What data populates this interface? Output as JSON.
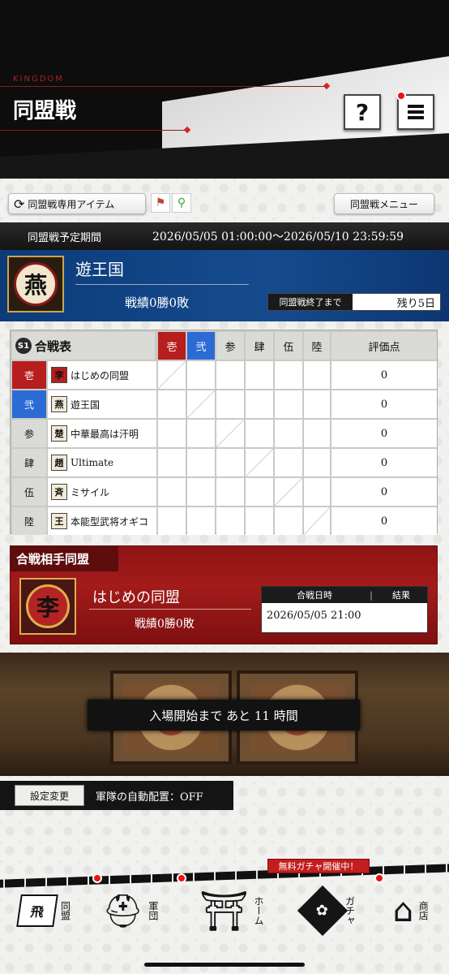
{
  "header": {
    "kingdom_label": "KINGDOM",
    "title": "同盟戦",
    "help_label": "?"
  },
  "toolbar": {
    "items_button": "同盟戦専用アイテム",
    "menu_button": "同盟戦メニュー"
  },
  "period": {
    "label": "同盟戦予定期間",
    "value": "2026/05/05 01:00:00～2026/05/10 23:59:59"
  },
  "my_alliance": {
    "emblem_char": "燕",
    "name": "遊王国",
    "record": "戦績0勝0敗",
    "remaining_label": "同盟戦終了まで",
    "remaining_value": "残り5日"
  },
  "battle_table": {
    "season_badge": "S1",
    "title": "合戦表",
    "columns": [
      "壱",
      "弐",
      "参",
      "肆",
      "伍",
      "陸"
    ],
    "score_header": "評価点",
    "rows": [
      {
        "label": "壱",
        "emblem": "李",
        "name": "はじめの同盟",
        "score": "0"
      },
      {
        "label": "弐",
        "emblem": "燕",
        "name": "遊王国",
        "score": "0"
      },
      {
        "label": "参",
        "emblem": "楚",
        "name": "中華最高は汗明",
        "score": "0"
      },
      {
        "label": "肆",
        "emblem": "趙",
        "name": "Ultimate",
        "score": "0"
      },
      {
        "label": "伍",
        "emblem": "斉",
        "name": "ミサイル",
        "score": "0"
      },
      {
        "label": "陸",
        "emblem": "王",
        "name": "本能型武将オギコ",
        "score": "0"
      }
    ]
  },
  "opponent": {
    "section_title": "合戦相手同盟",
    "emblem_char": "李",
    "name": "はじめの同盟",
    "record": "戦績0勝0敗",
    "date_header": "合戦日時",
    "result_header": "結果",
    "date_value": "2026/05/05 21:00"
  },
  "entry": {
    "countdown": "入場開始まで あと 11 時間"
  },
  "settings": {
    "button": "設定変更",
    "auto_deploy": "軍隊の自動配置：OFF"
  },
  "bottom_nav": {
    "promo": "無料ガチャ開催中！",
    "items": [
      {
        "label": "同盟",
        "icon": "飛"
      },
      {
        "label": "軍団",
        "icon": "helmet-icon"
      },
      {
        "label": "ホーム",
        "icon": "castle-icon"
      },
      {
        "label": "ガチャ",
        "icon": "gacha-icon"
      },
      {
        "label": "商店",
        "icon": "shop-icon"
      }
    ]
  },
  "colors": {
    "accent_red": "#b71e1e",
    "accent_blue": "#2c6bd3",
    "my_alliance_bg": "#154b8e"
  }
}
